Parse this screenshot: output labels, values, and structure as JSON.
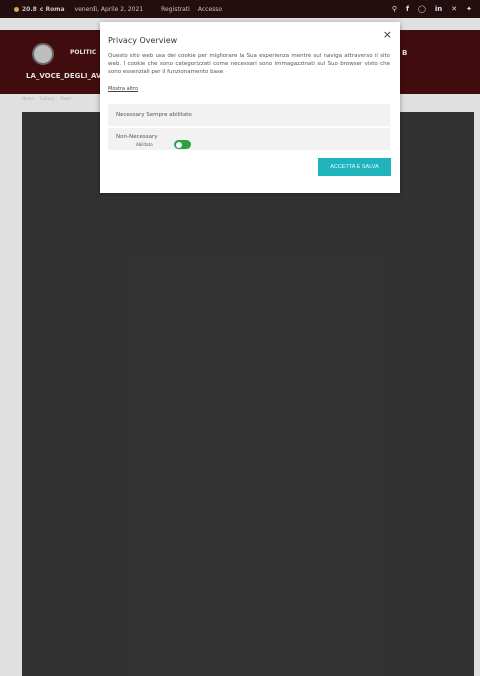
{
  "topbar": {
    "temperature": "20.8",
    "unit": "c Roma",
    "date": "venerdì, Aprile 2, 2021",
    "register": "Registrati",
    "login": "Accesso",
    "icons": [
      "search-icon",
      "facebook-icon",
      "instagram-icon",
      "linkedin-icon",
      "x-icon",
      "twitter-icon"
    ]
  },
  "header": {
    "site_name": "LA_VOCE_DEGLI_AV",
    "nav_first": "POLITIC",
    "nav_right": "B"
  },
  "breadcrumb": [
    "Home",
    "Cultura",
    "Teatri"
  ],
  "modal": {
    "close": "×",
    "title": "Privacy Overview",
    "description": "Questo sito web usa dei cookie per migliorare la Sua esperienza mentre sul naviga attraverso il sito web. I cookie che sono categorizzati come necessari sono immagazzinati sul Suo browser visto che sono essenziali per il funzionamento base",
    "more": "Mostra altro",
    "necessary_label": "Necessary Sempre abilitato",
    "non_necessary_label": "Non-Necessary",
    "toggle_text": "Abilitato",
    "accept": "ACCETTA E SALVA"
  },
  "colors": {
    "topbar": "#2a0f10",
    "header": "#4a0e0f",
    "accent": "#1fb4bb",
    "toggle_on": "#2fa145"
  }
}
